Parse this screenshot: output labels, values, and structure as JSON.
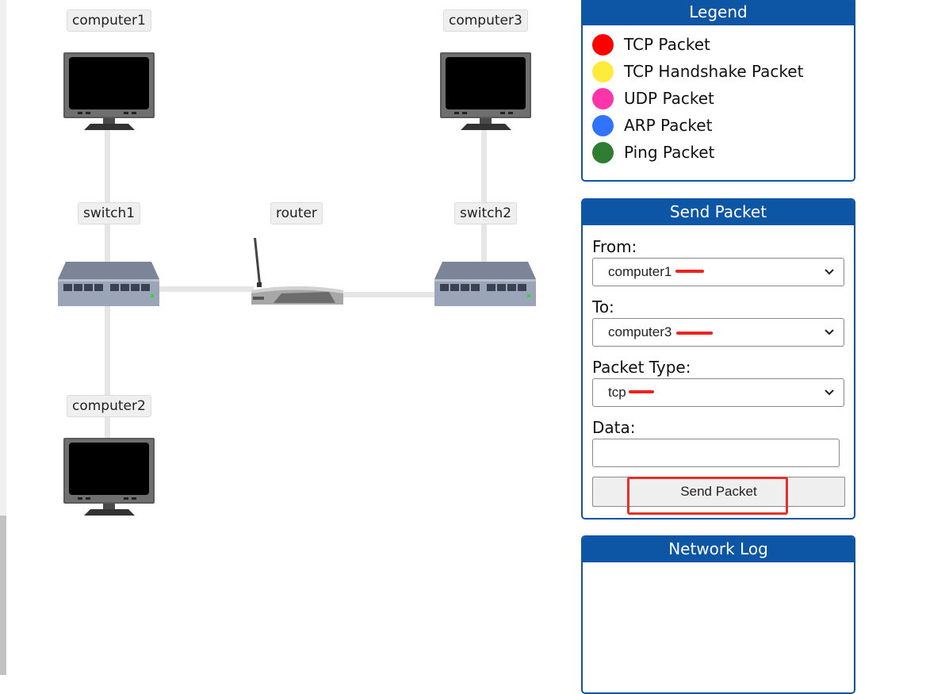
{
  "topology": {
    "nodes": [
      {
        "id": "computer1",
        "label": "computer1"
      },
      {
        "id": "computer2",
        "label": "computer2"
      },
      {
        "id": "computer3",
        "label": "computer3"
      },
      {
        "id": "switch1",
        "label": "switch1"
      },
      {
        "id": "switch2",
        "label": "switch2"
      },
      {
        "id": "router",
        "label": "router"
      }
    ]
  },
  "legend": {
    "title": "Legend",
    "items": [
      {
        "label": "TCP Packet",
        "color": "#ff0000"
      },
      {
        "label": "TCP Handshake Packet",
        "color": "#ffeb3b"
      },
      {
        "label": "UDP Packet",
        "color": "#ff33aa"
      },
      {
        "label": "ARP Packet",
        "color": "#2f73ff"
      },
      {
        "label": "Ping Packet",
        "color": "#2e7d32"
      }
    ]
  },
  "send_packet": {
    "title": "Send Packet",
    "from_label": "From:",
    "from_value": "computer1",
    "to_label": "To:",
    "to_value": "computer3",
    "type_label": "Packet Type:",
    "type_value": "tcp",
    "data_label": "Data:",
    "data_value": "",
    "button_label": "Send Packet"
  },
  "network_log": {
    "title": "Network Log",
    "entries": []
  },
  "colors": {
    "panel_blue": "#0d56a6",
    "annotation_red": "#e8302a"
  }
}
